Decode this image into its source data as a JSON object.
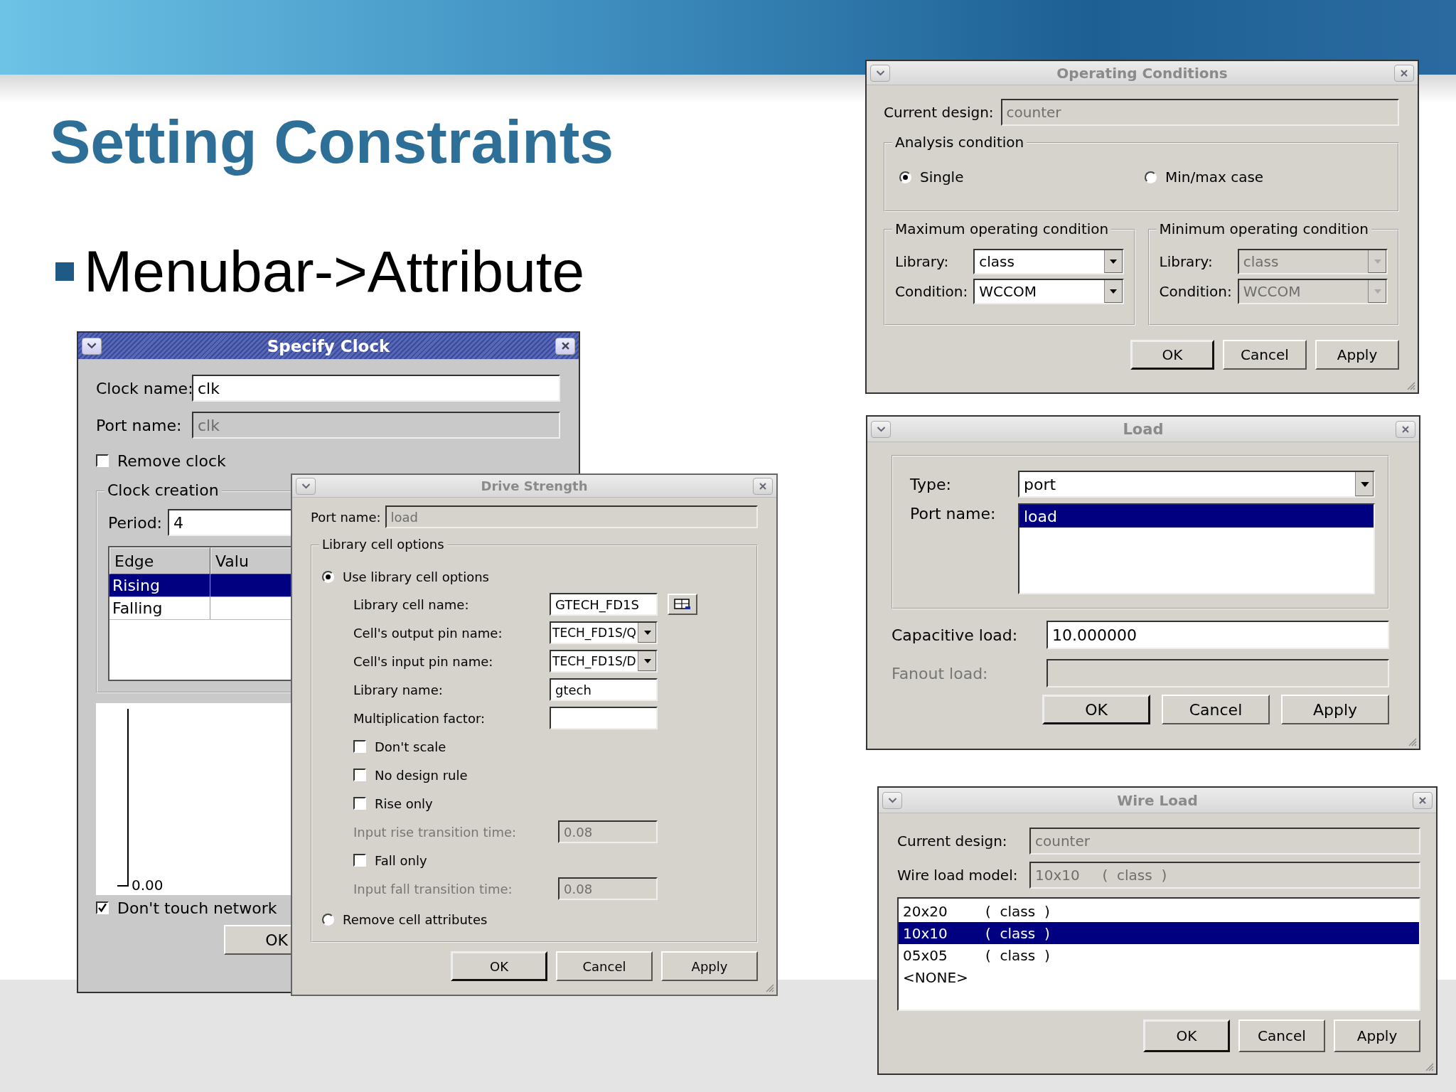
{
  "slide": {
    "title": "Setting Constraints",
    "bullet": "Menubar->Attribute"
  },
  "specify_clock": {
    "title": "Specify Clock",
    "active": true,
    "fields": [
      {
        "label": "Clock name:",
        "value": "clk",
        "disabled": false
      },
      {
        "label": "Port name:",
        "value": "clk",
        "disabled": true
      }
    ],
    "remove_clock": {
      "label": "Remove clock",
      "checked": false
    },
    "clock_creation": {
      "legend": "Clock creation",
      "period": {
        "label": "Period:",
        "value": "4",
        "disabled": false
      },
      "columns": [
        "Edge",
        "Valu"
      ],
      "rows": [
        {
          "edge": "Rising",
          "selected": true
        },
        {
          "edge": "Falling",
          "selected": false
        }
      ]
    },
    "waveform_label": "0.00",
    "dont_touch": {
      "label": "Don't touch network",
      "checked": true
    },
    "buttons": [
      {
        "label": "OK",
        "default": false
      }
    ]
  },
  "drive_strength": {
    "title": "Drive Strength",
    "active": false,
    "port": {
      "label": "Port name:",
      "value": "load",
      "disabled": true
    },
    "group": "Library cell options",
    "use_library": {
      "label": "Use library cell options",
      "selected": true
    },
    "items": [
      {
        "kind": "browse",
        "label": "Library cell name:",
        "value": "GTECH_FD1S",
        "disabled": false
      },
      {
        "kind": "dropdown",
        "label": "Cell's output pin name:",
        "value": "TECH_FD1S/Q",
        "disabled": false
      },
      {
        "kind": "dropdown",
        "label": "Cell's input pin name:",
        "value": "TECH_FD1S/D",
        "disabled": false
      },
      {
        "kind": "field",
        "label": "Library name:",
        "value": "gtech",
        "disabled": false
      },
      {
        "kind": "field",
        "label": "Multiplication factor:",
        "disabled": false
      },
      {
        "kind": "checkbox",
        "label": "Don't scale",
        "checked": false
      },
      {
        "kind": "checkbox",
        "label": "No design rule",
        "checked": false
      },
      {
        "kind": "checkbox",
        "label": "Rise only",
        "checked": false
      },
      {
        "kind": "field",
        "label": "Input rise transition time:",
        "value": "0.08",
        "disabled": true
      },
      {
        "kind": "checkbox",
        "label": "Fall only",
        "checked": false
      },
      {
        "kind": "field",
        "label": "Input fall transition time:",
        "value": "0.08",
        "disabled": true
      }
    ],
    "remove": {
      "label": "Remove cell attributes",
      "selected": false
    },
    "buttons": [
      {
        "label": "OK",
        "default": true
      },
      {
        "label": "Cancel",
        "default": false
      },
      {
        "label": "Apply",
        "default": false
      }
    ]
  },
  "operating_conditions": {
    "title": "Operating Conditions",
    "active": false,
    "design": {
      "label": "Current design:",
      "value": "counter",
      "disabled": true
    },
    "analysis": {
      "legend": "Analysis condition",
      "options": [
        {
          "label": "Single",
          "selected": true
        },
        {
          "label": "Min/max case",
          "selected": false
        }
      ]
    },
    "groups": [
      {
        "legend": "Maximum operating condition",
        "disabled": false,
        "library_label": "Library:",
        "library": "class",
        "condition_label": "Condition:",
        "condition": "WCCOM"
      },
      {
        "legend": "Minimum operating condition",
        "disabled": true,
        "library_label": "Library:",
        "library": "class",
        "condition_label": "Condition:",
        "condition": "WCCOM"
      }
    ],
    "buttons": [
      {
        "label": "OK",
        "default": true
      },
      {
        "label": "Cancel",
        "default": false
      },
      {
        "label": "Apply",
        "default": false
      }
    ]
  },
  "load": {
    "title": "Load",
    "active": false,
    "type": {
      "label": "Type:",
      "value": "port",
      "disabled": false
    },
    "port_label": "Port name:",
    "ports": [
      {
        "name": "load",
        "selected": true
      }
    ],
    "capacitive": {
      "label": "Capacitive load:",
      "value": "10.000000",
      "disabled": false
    },
    "fanout": {
      "label": "Fanout load:",
      "disabled": true
    },
    "buttons": [
      {
        "label": "OK",
        "default": true
      },
      {
        "label": "Cancel",
        "default": false
      },
      {
        "label": "Apply",
        "default": false
      }
    ]
  },
  "wire_load": {
    "title": "Wire Load",
    "active": false,
    "design": {
      "label": "Current design:",
      "value": "counter",
      "disabled": true
    },
    "model": {
      "label": "Wire load model:",
      "value": "10x10     (  class  )",
      "disabled": true
    },
    "models": [
      {
        "name": "20x20",
        "library": "(  class  )",
        "selected": false
      },
      {
        "name": "10x10",
        "library": "(  class  )",
        "selected": true
      },
      {
        "name": "05x05",
        "library": "(  class  )",
        "selected": false
      },
      {
        "name": "<NONE>",
        "selected": false
      }
    ],
    "buttons": [
      {
        "label": "OK",
        "default": true
      },
      {
        "label": "Cancel",
        "default": false
      },
      {
        "label": "Apply",
        "default": false
      }
    ]
  }
}
